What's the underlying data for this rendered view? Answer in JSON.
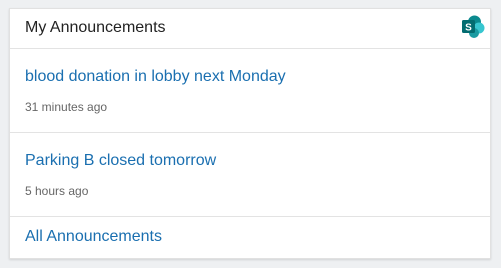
{
  "card": {
    "title": "My Announcements",
    "icon": "sharepoint-icon",
    "icon_letter": "S"
  },
  "announcements": [
    {
      "title": "blood donation in lobby next Monday",
      "time": "31 minutes ago"
    },
    {
      "title": "Parking B closed tomorrow",
      "time": "5 hours ago"
    }
  ],
  "footer": {
    "link": "All Announcements"
  },
  "colors": {
    "link": "#1a6fb0",
    "icon_dark": "#036c70",
    "icon_light": "#37c6d0"
  }
}
